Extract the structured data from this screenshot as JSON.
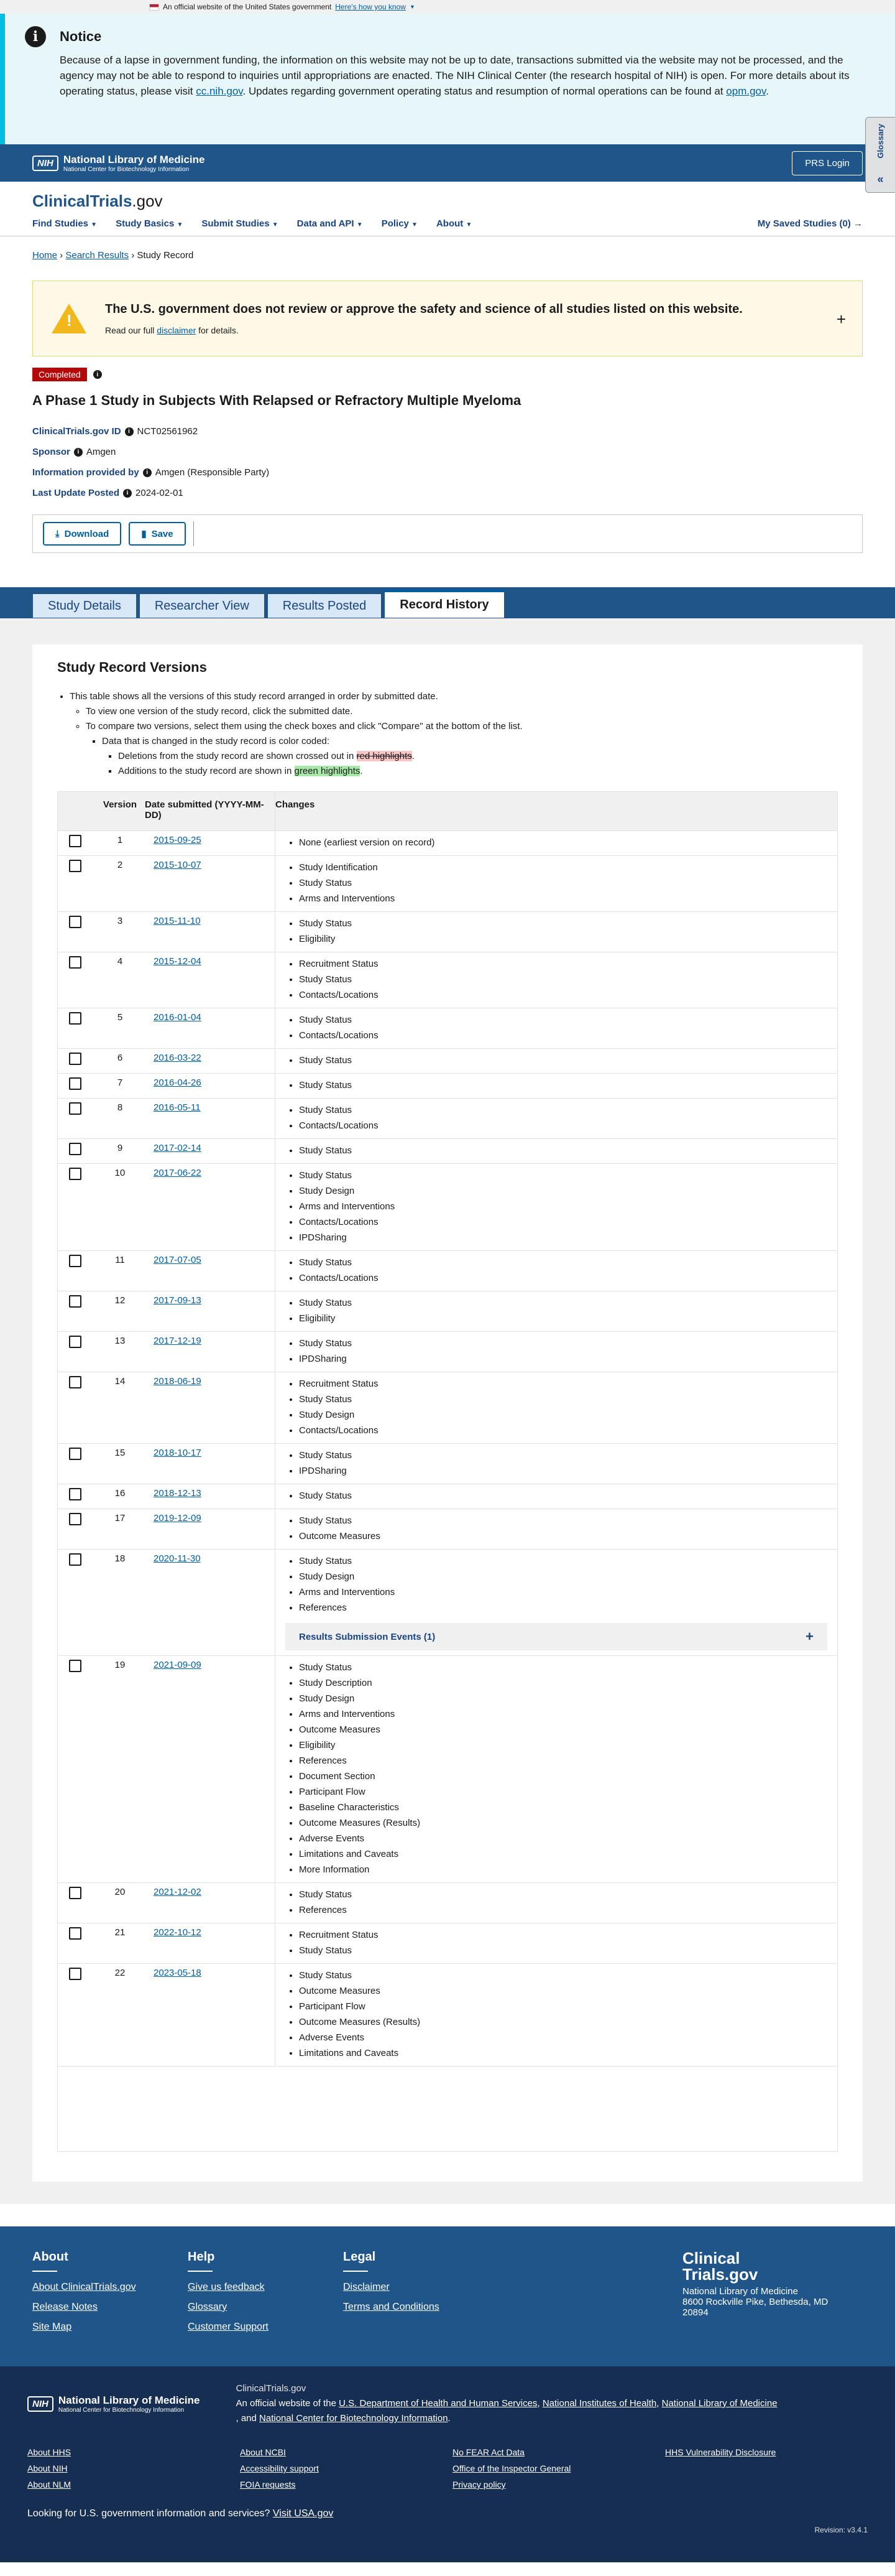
{
  "gov_banner": {
    "text": "An official website of the United States government",
    "link": "Here's how you know"
  },
  "notice": {
    "title": "Notice",
    "body_pre": "Because of a lapse in government funding, the information on this website may not be up to date, transactions submitted via the website may not be processed, and the agency may not be able to respond to inquiries until appropriations are enacted. The NIH Clinical Center (the research hospital of NIH) is open. For more details about its operating status, please visit ",
    "link1": "cc.nih.gov",
    "body_mid": ". Updates regarding government operating status and resumption of normal operations can be found at ",
    "link2": "opm.gov",
    "body_end": "."
  },
  "nlm": {
    "box": "NIH",
    "name": "National Library of Medicine",
    "sub": "National Center for Biotechnology Information",
    "prs_login": "PRS Login"
  },
  "glossary": "Glossary",
  "brand": {
    "main": "ClinicalTrials",
    "suffix": ".gov"
  },
  "nav": {
    "items": [
      "Find Studies",
      "Study Basics",
      "Submit Studies",
      "Data and API",
      "Policy",
      "About"
    ],
    "saved": "My Saved Studies (0)"
  },
  "breadcrumb": {
    "home": "Home",
    "search": "Search Results",
    "current": "Study Record"
  },
  "warning": {
    "title": "The U.S. government does not review or approve the safety and science of all studies listed on this website.",
    "pre": "Read our full ",
    "link": "disclaimer",
    "post": " for details."
  },
  "status": "Completed",
  "study_title": "A Phase 1 Study in Subjects With Relapsed or Refractory Multiple Myeloma",
  "meta": {
    "id_label": "ClinicalTrials.gov ID",
    "id": "NCT02561962",
    "sponsor_label": "Sponsor",
    "sponsor": "Amgen",
    "provided_label": "Information provided by",
    "provided": "Amgen (Responsible Party)",
    "updated_label": "Last Update Posted",
    "updated": "2024-02-01"
  },
  "actions": {
    "download": "Download",
    "save": "Save"
  },
  "tabs": [
    "Study Details",
    "Researcher View",
    "Results Posted",
    "Record History"
  ],
  "versions": {
    "heading": "Study Record Versions",
    "intro": "This table shows all the versions of this study record arranged in order by submitted date.",
    "view_one": "To view one version of the study record, click the submitted date.",
    "compare": "To compare two versions, select them using the check boxes and click \"Compare\" at the bottom of the list.",
    "color": "Data that is changed in the study record is color coded:",
    "deletions_pre": "Deletions from the study record are shown crossed out in ",
    "deletions_hl": "red highlights",
    "additions_pre": "Additions to the study record are shown in ",
    "additions_hl": "green highlights",
    "col_version": "Version",
    "col_date": "Date submitted (YYYY-MM-DD)",
    "col_changes": "Changes",
    "results_events": "Results Submission Events (1)",
    "rows": [
      {
        "v": "1",
        "d": "2015-09-25",
        "c": [
          "None (earliest version on record)"
        ]
      },
      {
        "v": "2",
        "d": "2015-10-07",
        "c": [
          "Study Identification",
          "Study Status",
          "Arms and Interventions"
        ]
      },
      {
        "v": "3",
        "d": "2015-11-10",
        "c": [
          "Study Status",
          "Eligibility"
        ]
      },
      {
        "v": "4",
        "d": "2015-12-04",
        "c": [
          "Recruitment Status",
          "Study Status",
          "Contacts/Locations"
        ]
      },
      {
        "v": "5",
        "d": "2016-01-04",
        "c": [
          "Study Status",
          "Contacts/Locations"
        ]
      },
      {
        "v": "6",
        "d": "2016-03-22",
        "c": [
          "Study Status"
        ]
      },
      {
        "v": "7",
        "d": "2016-04-26",
        "c": [
          "Study Status"
        ]
      },
      {
        "v": "8",
        "d": "2016-05-11",
        "c": [
          "Study Status",
          "Contacts/Locations"
        ]
      },
      {
        "v": "9",
        "d": "2017-02-14",
        "c": [
          "Study Status"
        ]
      },
      {
        "v": "10",
        "d": "2017-06-22",
        "c": [
          "Study Status",
          "Study Design",
          "Arms and Interventions",
          "Contacts/Locations",
          "IPDSharing"
        ]
      },
      {
        "v": "11",
        "d": "2017-07-05",
        "c": [
          "Study Status",
          "Contacts/Locations"
        ]
      },
      {
        "v": "12",
        "d": "2017-09-13",
        "c": [
          "Study Status",
          "Eligibility"
        ]
      },
      {
        "v": "13",
        "d": "2017-12-19",
        "c": [
          "Study Status",
          "IPDSharing"
        ]
      },
      {
        "v": "14",
        "d": "2018-06-19",
        "c": [
          "Recruitment Status",
          "Study Status",
          "Study Design",
          "Contacts/Locations"
        ]
      },
      {
        "v": "15",
        "d": "2018-10-17",
        "c": [
          "Study Status",
          "IPDSharing"
        ]
      },
      {
        "v": "16",
        "d": "2018-12-13",
        "c": [
          "Study Status"
        ]
      },
      {
        "v": "17",
        "d": "2019-12-09",
        "c": [
          "Study Status",
          "Outcome Measures"
        ]
      },
      {
        "v": "18",
        "d": "2020-11-30",
        "c": [
          "Study Status",
          "Study Design",
          "Arms and Interventions",
          "References"
        ],
        "events": true
      },
      {
        "v": "19",
        "d": "2021-09-09",
        "c": [
          "Study Status",
          "Study Description",
          "Study Design",
          "Arms and Interventions",
          "Outcome Measures",
          "Eligibility",
          "References",
          "Document Section",
          "Participant Flow",
          "Baseline Characteristics",
          "Outcome Measures (Results)",
          "Adverse Events",
          "Limitations and Caveats",
          "More Information"
        ]
      },
      {
        "v": "20",
        "d": "2021-12-02",
        "c": [
          "Study Status",
          "References"
        ]
      },
      {
        "v": "21",
        "d": "2022-10-12",
        "c": [
          "Recruitment Status",
          "Study Status"
        ]
      },
      {
        "v": "22",
        "d": "2023-05-18",
        "c": [
          "Study Status",
          "Outcome Measures",
          "Participant Flow",
          "Outcome Measures (Results)",
          "Adverse Events",
          "Limitations and Caveats"
        ]
      }
    ]
  },
  "footer": {
    "about": {
      "title": "About",
      "links": [
        "About ClinicalTrials.gov",
        "Release Notes",
        "Site Map"
      ]
    },
    "help": {
      "title": "Help",
      "links": [
        "Give us feedback",
        "Glossary",
        "Customer Support"
      ]
    },
    "legal": {
      "title": "Legal",
      "links": [
        "Disclaimer",
        "Terms and Conditions"
      ]
    },
    "address": {
      "brand1": "Clinical",
      "brand2": "Trials.gov",
      "org": "National Library of Medicine",
      "street": "8600 Rockville Pike, Bethesda, MD",
      "zip": "20894"
    }
  },
  "footer2": {
    "nlm_box": "NIH",
    "nlm_name": "National Library of Medicine",
    "nlm_sub": "National Center for Biotechnology Information",
    "site": "ClinicalTrials.gov",
    "official_pre": "An official website of the ",
    "hhs": "U.S. Department of Health and Human Services",
    "nih": "National Institutes of Health",
    "nlm": "National Library of Medicine",
    "and": ", and ",
    "ncbi": "National Center for Biotechnology Information",
    "links": [
      "About HHS",
      "About NCBI",
      "No FEAR Act Data",
      "HHS Vulnerability Disclosure",
      "About NIH",
      "Accessibility support",
      "Office of the Inspector General",
      "",
      "About NLM",
      "FOIA requests",
      "Privacy policy",
      ""
    ],
    "usa_pre": "Looking for U.S. government information and services?",
    "usa_link": "Visit USA.gov",
    "revision": "Revision: v3.4.1"
  }
}
